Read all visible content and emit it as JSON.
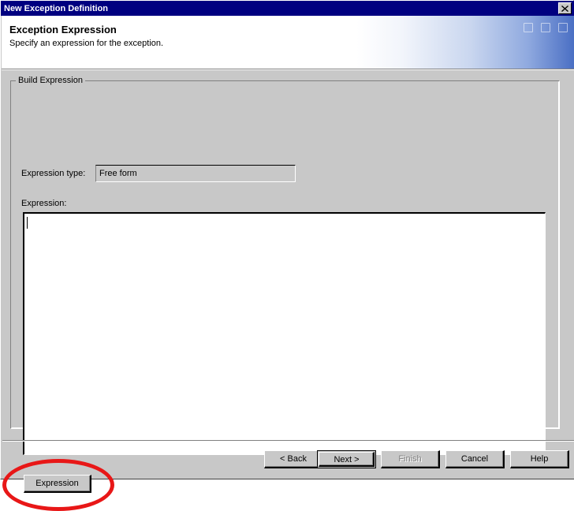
{
  "window": {
    "title": "New Exception Definition",
    "close_icon": "close-x-icon"
  },
  "header": {
    "title": "Exception Expression",
    "subtitle": "Specify an expression for the exception.",
    "decorative_squares": 3,
    "gradient_accent_color": "#4a6fc4"
  },
  "groupbox": {
    "legend": "Build Expression"
  },
  "form": {
    "expression_type": {
      "label": "Expression type:",
      "value": "Free form",
      "enabled": false
    },
    "expression": {
      "label": "Expression:",
      "value": "",
      "placeholder": "",
      "caret_visible": true
    },
    "expression_button": {
      "label": "Expression"
    }
  },
  "annotation": {
    "shape": "ellipse",
    "color": "#e81717",
    "targets": "expression-button"
  },
  "footer": {
    "buttons": [
      {
        "label": "< Back",
        "state": "enabled",
        "name": "back-button"
      },
      {
        "label": "Next >",
        "state": "focused",
        "name": "next-button"
      },
      {
        "label": "Finish",
        "state": "disabled",
        "name": "finish-button"
      },
      {
        "label": "Cancel",
        "state": "enabled",
        "name": "cancel-button"
      },
      {
        "label": "Help",
        "state": "enabled",
        "name": "help-button"
      }
    ]
  },
  "theme": {
    "titlebar_color": "#000080",
    "face_color": "#c8c8c8",
    "field_color": "#ffffff",
    "text_color": "#000000",
    "disabled_text_color": "#808080"
  }
}
